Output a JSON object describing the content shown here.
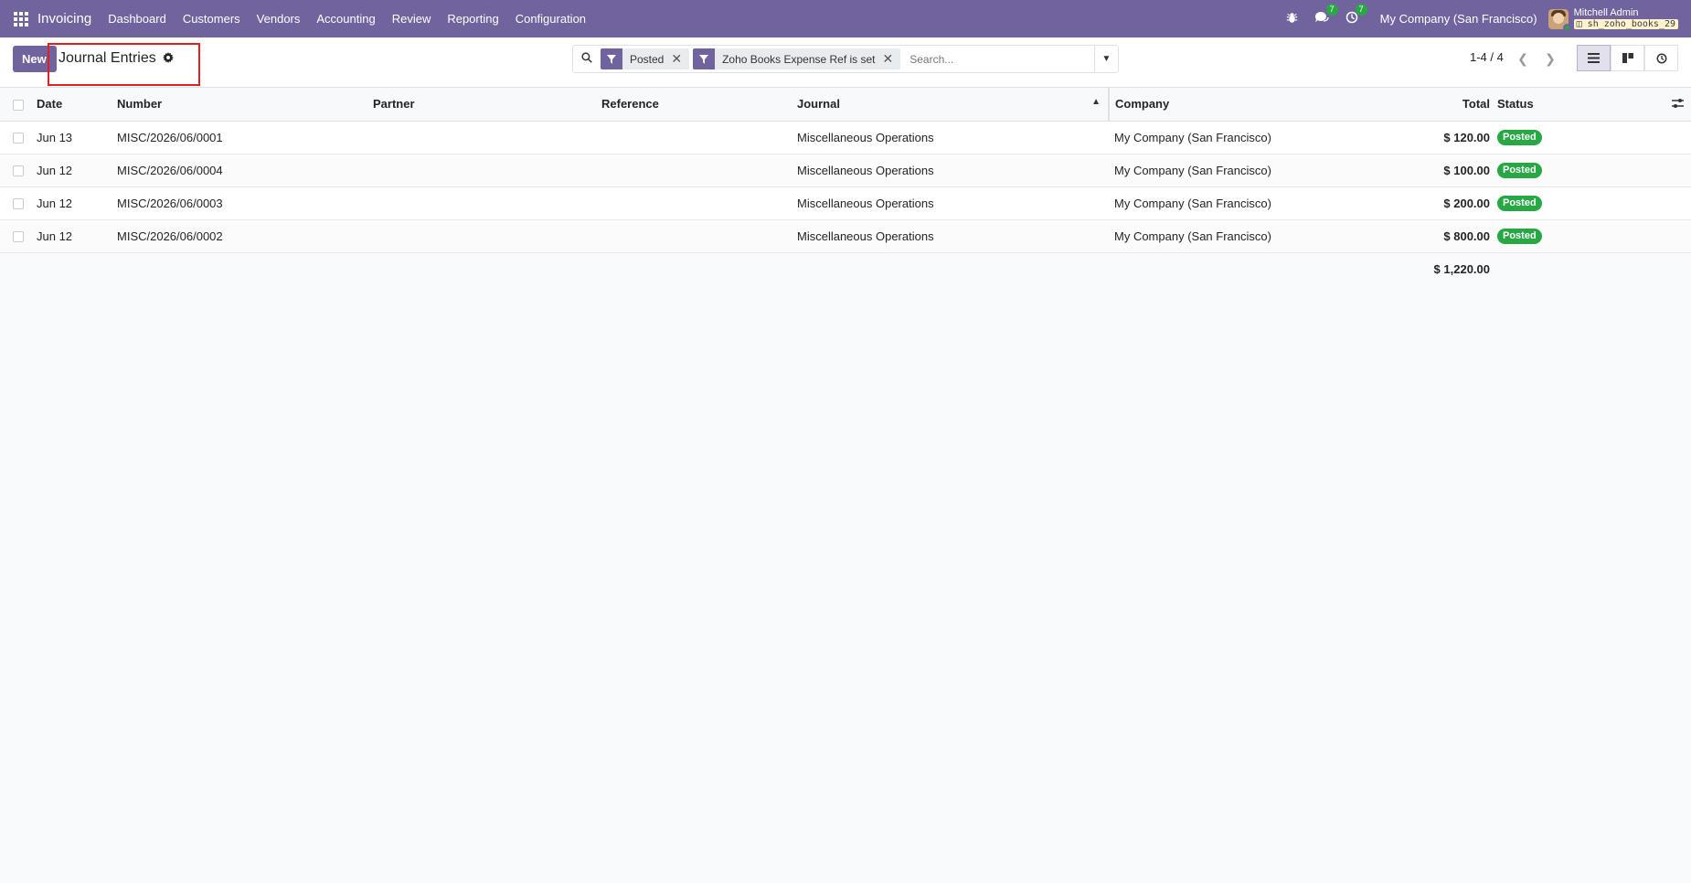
{
  "navbar": {
    "brand": "Invoicing",
    "menu": [
      "Dashboard",
      "Customers",
      "Vendors",
      "Accounting",
      "Review",
      "Reporting",
      "Configuration"
    ],
    "messages_count": "7",
    "activities_count": "7",
    "company": "My Company (San Francisco)",
    "user_name": "Mitchell Admin",
    "db_name": "sh_zoho_books_29"
  },
  "control_panel": {
    "new_label": "New",
    "title": "Journal Entries",
    "facets": [
      {
        "label": "Posted"
      },
      {
        "label": "Zoho Books Expense Ref is set"
      }
    ],
    "search_placeholder": "Search...",
    "pager": "1-4 / 4"
  },
  "table": {
    "columns": [
      "Date",
      "Number",
      "Partner",
      "Reference",
      "Journal",
      "Company",
      "Total",
      "Status"
    ],
    "rows": [
      {
        "date": "Jun 13",
        "number": "MISC/2026/06/0001",
        "partner": "",
        "reference": "",
        "journal": "Miscellaneous Operations",
        "company": "My Company (San Francisco)",
        "total": "$ 120.00",
        "status": "Posted"
      },
      {
        "date": "Jun 12",
        "number": "MISC/2026/06/0004",
        "partner": "",
        "reference": "",
        "journal": "Miscellaneous Operations",
        "company": "My Company (San Francisco)",
        "total": "$ 100.00",
        "status": "Posted"
      },
      {
        "date": "Jun 12",
        "number": "MISC/2026/06/0003",
        "partner": "",
        "reference": "",
        "journal": "Miscellaneous Operations",
        "company": "My Company (San Francisco)",
        "total": "$ 200.00",
        "status": "Posted"
      },
      {
        "date": "Jun 12",
        "number": "MISC/2026/06/0002",
        "partner": "",
        "reference": "",
        "journal": "Miscellaneous Operations",
        "company": "My Company (San Francisco)",
        "total": "$ 800.00",
        "status": "Posted"
      }
    ],
    "grand_total": "$ 1,220.00"
  },
  "colors": {
    "brand": "#71639e",
    "posted": "#28a745",
    "highlight": "#e02020"
  }
}
